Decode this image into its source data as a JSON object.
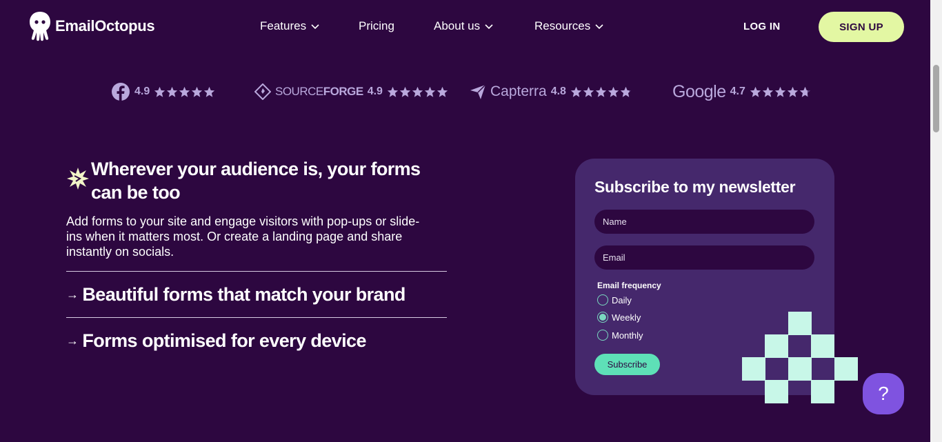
{
  "header": {
    "logo_text": "EmailOctopus",
    "nav": [
      {
        "label": "Features",
        "has_dropdown": true
      },
      {
        "label": "Pricing",
        "has_dropdown": false
      },
      {
        "label": "About us",
        "has_dropdown": true
      },
      {
        "label": "Resources",
        "has_dropdown": true
      }
    ],
    "login_label": "LOG IN",
    "signup_label": "SIGN UP"
  },
  "ratings": [
    {
      "brand": "facebook-icon",
      "score": "4.9",
      "stars": 5
    },
    {
      "brand": "sourceforge",
      "brand_text_light": "SOURCE",
      "brand_text_bold": "FORGE",
      "score": "4.9",
      "stars": 5
    },
    {
      "brand": "capterra",
      "brand_text": "Capterra",
      "score": "4.8",
      "stars": 4.8
    },
    {
      "brand": "google",
      "brand_text": "Google",
      "score": "4.7",
      "stars": 4.7
    }
  ],
  "main": {
    "headline": "Wherever your audience is, your forms can be too",
    "description": "Add forms to your site and engage visitors with pop-ups or slide-ins when it matters most. Or create a landing page and share instantly on socials.",
    "features": [
      {
        "arrow": "→",
        "label": "Beautiful forms that match your brand"
      },
      {
        "arrow": "→",
        "label": "Forms optimised for every device"
      }
    ]
  },
  "form_card": {
    "title": "Subscribe to my newsletter",
    "name_placeholder": "Name",
    "email_placeholder": "Email",
    "frequency_label": "Email frequency",
    "options": [
      {
        "label": "Daily",
        "checked": false
      },
      {
        "label": "Weekly",
        "checked": true
      },
      {
        "label": "Monthly",
        "checked": false
      }
    ],
    "subscribe_label": "Subscribe"
  },
  "help_button": {
    "icon": "question-icon",
    "label": "?"
  },
  "colors": {
    "background": "#2d0740",
    "signup": "#e3f7a3",
    "card": "#45286c",
    "accent_teal": "#5ee0b7",
    "help": "#7f53e0"
  }
}
